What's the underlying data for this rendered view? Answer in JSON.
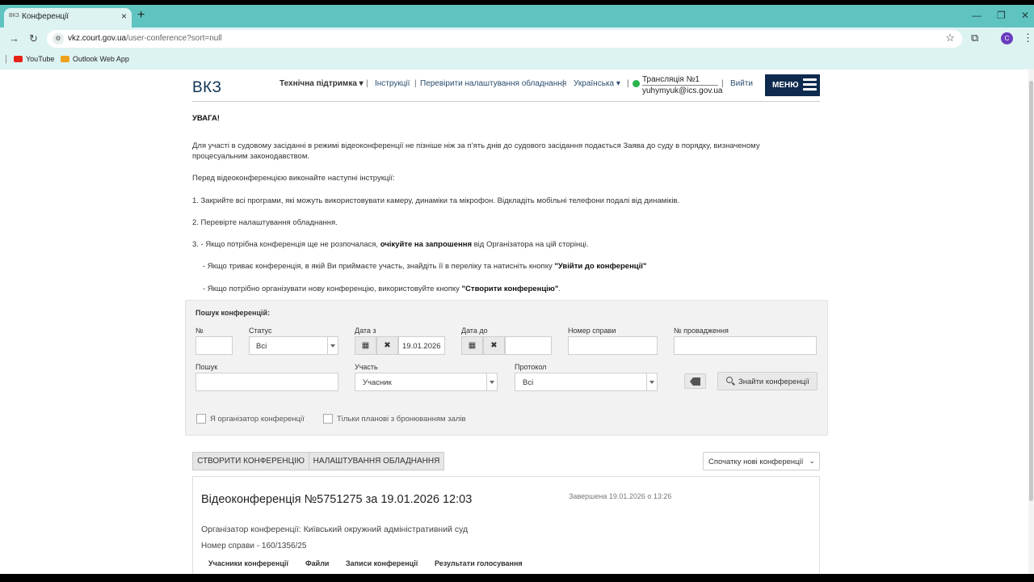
{
  "browser": {
    "tab_favicon": "ВКЗ",
    "tab_title": "Конференції",
    "tab_close": "×",
    "new_tab": "+",
    "window_controls": [
      "—",
      "❐",
      "✕"
    ],
    "nav_back": "←",
    "nav_forward": "→",
    "nav_reload": "↻",
    "url_host": "vkz.court.gov.ua",
    "url_path": "/user-conference?sort=null",
    "star": "☆",
    "extensions": "⧉",
    "profile_initial": "C",
    "menu": "⋮",
    "bookmarks": [
      {
        "label": "YouTube",
        "color": "#e62117"
      },
      {
        "label": "Outlook Web App",
        "color": "#f0a11c"
      }
    ]
  },
  "header": {
    "logo": "ВКЗ",
    "support": "Технічна підтримка ▾",
    "instructions": "Інструкції",
    "check_settings": "Перевірити налаштування обладнання",
    "language": "Українська ▾",
    "broadcast": "Трансляція №1",
    "email": "yuhymyuk@ics.gov.ua",
    "logout": "Вийти",
    "menu_label": "МЕНЮ",
    "status_color": "#2bb24c"
  },
  "notice": {
    "heading": "УВАГА!",
    "para1_line1": "Для участі в судовому засіданні в режимі відеоконференції не пізніше ніж за п’ять днів до судового засідання подається Заява до суду в порядку, визначеному",
    "para1_line2": "процесуальним законодавством.",
    "para2": "Перед відеоконференцією виконайте наступні інструкції:",
    "step1": "1. Закрийте всі програми, які можуть використовувати камеру, динаміки та мікрофон. Відкладіть мобільні телефони подалі від динаміків.",
    "step2": "2. Перевірте налаштування обладнання.",
    "step3_pre": "3.  - Якщо потрібна конференція ще не розпочалася, ",
    "step3_bold": "очікуйте на запрошення",
    "step3_post": " від Організатора на цій сторінці.",
    "step4_pre": "- Якщо триває конференція, в якій Ви приймаєте участь, знайдіть її в переліку та натисніть кнопку ",
    "step4_bold": "\"Увійти до конференції\"",
    "step5_pre": "- Якщо потрібно організувати нову конференцію, використовуйте кнопку ",
    "step5_bold": "\"Створити конференцію\"",
    "step5_post": "."
  },
  "search": {
    "title": "Пошук конференцій:",
    "num_label": "№",
    "status_label": "Статус",
    "status_value": "Всі",
    "date_from_label": "Дата з",
    "date_from_value": "19.01.2026",
    "date_to_label": "Дата до",
    "case_label": "Номер справи",
    "proc_label": "№ провадження",
    "query_label": "Пошук",
    "role_label": "Участь",
    "role_value": "Учасник",
    "protocol_label": "Протокол",
    "protocol_value": "Всі",
    "calendar_icon": "▦",
    "clear_icon": "✖",
    "find_label": "Знайти конференції",
    "organizer_check": "Я організатор конференції",
    "planned_check": "Тільки планові з бронюванням залів"
  },
  "actions": {
    "create": "СТВОРИТИ КОНФЕРЕНЦІЮ",
    "settings": "НАЛАШТУВАННЯ ОБЛАДНАННЯ",
    "sort_value": "Спочатку нові конференції",
    "sort_chevron": "⌄"
  },
  "conference": {
    "title": "Відеоконференція №5751275 за 19.01.2026 12:03",
    "status": "Завершена 19.01.2026 о 13:26",
    "organizer": "Організатор конференції: Київський окружний адміністративний суд",
    "case": "Номер справи - 160/1356/25",
    "tabs": [
      "Учасники конференції",
      "Файли",
      "Записи конференції",
      "Результати голосування"
    ]
  }
}
